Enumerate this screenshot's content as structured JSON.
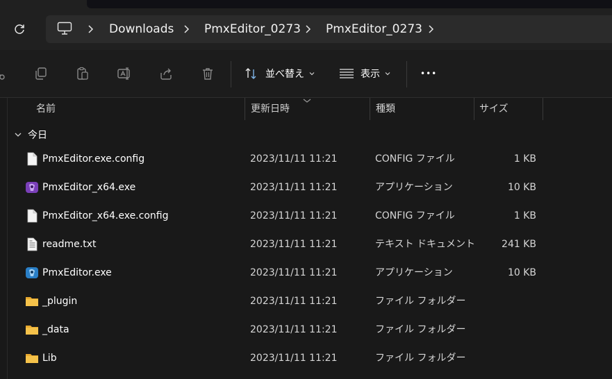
{
  "address_bar": {
    "breadcrumbs": [
      "Downloads",
      "PmxEditor_0273",
      "PmxEditor_0273"
    ],
    "root_icon": "monitor-icon"
  },
  "toolbar": {
    "sort_label": "並べ替え",
    "view_label": "表示",
    "more_label": "•••",
    "icons": [
      "cut-icon",
      "copy-icon",
      "paste-icon",
      "rename-icon",
      "share-icon",
      "delete-icon"
    ]
  },
  "columns": {
    "name": "名前",
    "modified": "更新日時",
    "type": "種類",
    "size": "サイズ"
  },
  "group": {
    "label": "今日"
  },
  "files": [
    {
      "name": "PmxEditor.exe.config",
      "modified": "2023/11/11 11:21",
      "type": "CONFIG ファイル",
      "size": "1 KB",
      "icon": "file-icon"
    },
    {
      "name": "PmxEditor_x64.exe",
      "modified": "2023/11/11 11:21",
      "type": "アプリケーション",
      "size": "10 KB",
      "icon": "app-purple-icon"
    },
    {
      "name": "PmxEditor_x64.exe.config",
      "modified": "2023/11/11 11:21",
      "type": "CONFIG ファイル",
      "size": "1 KB",
      "icon": "file-icon"
    },
    {
      "name": "readme.txt",
      "modified": "2023/11/11 11:21",
      "type": "テキスト ドキュメント",
      "size": "241 KB",
      "icon": "text-file-icon"
    },
    {
      "name": "PmxEditor.exe",
      "modified": "2023/11/11 11:21",
      "type": "アプリケーション",
      "size": "10 KB",
      "icon": "app-blue-icon"
    },
    {
      "name": "_plugin",
      "modified": "2023/11/11 11:21",
      "type": "ファイル フォルダー",
      "size": "",
      "icon": "folder-icon"
    },
    {
      "name": "_data",
      "modified": "2023/11/11 11:21",
      "type": "ファイル フォルダー",
      "size": "",
      "icon": "folder-icon"
    },
    {
      "name": "Lib",
      "modified": "2023/11/11 11:21",
      "type": "ファイル フォルダー",
      "size": "",
      "icon": "folder-icon"
    }
  ],
  "colors": {
    "background": "#191919",
    "toolbar": "#1c1c1c",
    "address_bg": "#2b2b2b",
    "folder": "#f5c24a"
  }
}
